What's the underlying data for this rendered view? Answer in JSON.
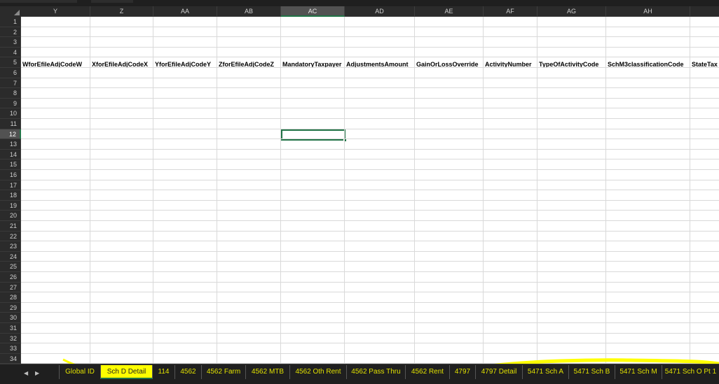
{
  "sheet": {
    "columns": [
      "Y",
      "Z",
      "AA",
      "AB",
      "AC",
      "AD",
      "AE",
      "AF",
      "AG",
      "AH"
    ],
    "selected_column": "AC",
    "rows": [
      "1",
      "2",
      "3",
      "4",
      "5",
      "6",
      "7",
      "8",
      "9",
      "10",
      "11",
      "12",
      "13",
      "14",
      "15",
      "16",
      "17",
      "18",
      "19",
      "20",
      "21",
      "22",
      "23",
      "24",
      "25",
      "26",
      "27",
      "28",
      "29",
      "30",
      "31",
      "32",
      "33",
      "34"
    ],
    "selected_row": "12",
    "header_row": {
      "row": "5",
      "cells": [
        "WforEfileAdjCodeW",
        "XforEfileAdjCodeX",
        "YforEfileAdjCodeY",
        "ZforEfileAdjCodeZ",
        "MandatoryTaxpayer",
        "AdjustmentsAmount",
        "GainOrLossOverride",
        "ActivityNumber",
        "TypeOfActivityCode",
        "SchM3classificationCode",
        "StateTax"
      ]
    }
  },
  "tabs": {
    "nav_prev": "◀",
    "nav_next": "▶",
    "items": [
      "Global ID",
      "Sch D Detail",
      "114",
      "4562",
      "4562 Farm",
      "4562 MTB",
      "4562 Oth Rent",
      "4562 Pass Thru",
      "4562 Rent",
      "4797",
      "4797 Detail",
      "5471 Sch A",
      "5471 Sch B",
      "5471 Sch M",
      "5471 Sch O Pt 1"
    ],
    "active": "Sch D Detail"
  },
  "colors": {
    "selection": "#217346",
    "tab_text": "#e0e000",
    "active_tab_bg": "#ffff00"
  }
}
